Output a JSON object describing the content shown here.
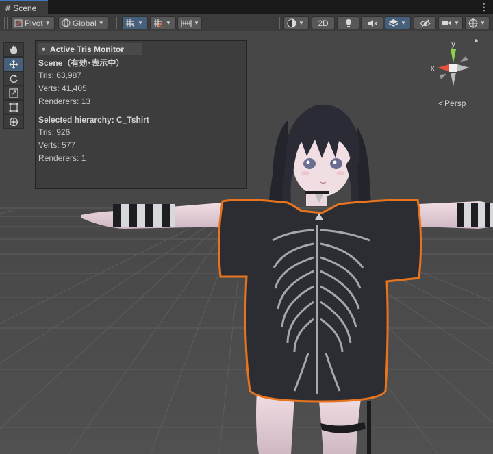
{
  "tab": {
    "icon": "grid-hash-icon",
    "label": "Scene"
  },
  "toolbar": {
    "pivot_label": "Pivot",
    "global_label": "Global",
    "twod_label": "2D"
  },
  "tools": [
    "hand-tool-icon",
    "move-tool-icon",
    "rotate-tool-icon",
    "scale-tool-icon",
    "rect-tool-icon",
    "transform-tool-icon"
  ],
  "panel": {
    "title": "Active Tris Monitor",
    "scene_header": "Scene（有効･表示中）",
    "scene_tris": "Tris: 63,987",
    "scene_verts": "Verts: 41,405",
    "scene_renderers": "Renderers: 13",
    "selected_header": "Selected hierarchy: C_Tshirt",
    "sel_tris": "Tris: 926",
    "sel_verts": "Verts: 577",
    "sel_renderers": "Renderers: 1"
  },
  "gizmo": {
    "y_label": "y",
    "x_label": "x",
    "persp_label": "Persp"
  },
  "colors": {
    "selection_outline": "#e8741e",
    "active_button": "#46607c",
    "gizmo_y": "#8ed14a",
    "gizmo_x": "#e4523c"
  }
}
